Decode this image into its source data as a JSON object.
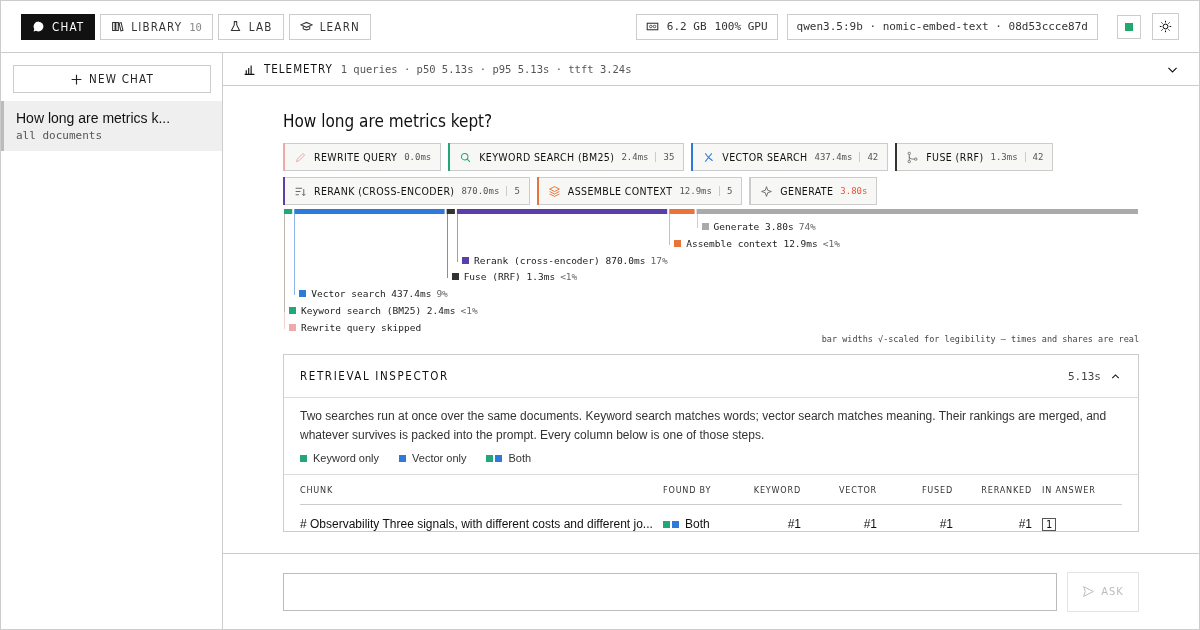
{
  "nav": {
    "tabs": [
      {
        "label": "CHAT",
        "selected": true
      },
      {
        "label": "LIBRARY",
        "count": "10",
        "selected": false
      },
      {
        "label": "LAB",
        "selected": false
      },
      {
        "label": "LEARN",
        "selected": false
      }
    ],
    "memory": "6.2 GB",
    "gpu": "100% GPU",
    "models": "qwen3.5:9b · nomic-embed-text · 08d53ccce87d"
  },
  "sidebar": {
    "new_chat": "NEW CHAT",
    "chats": [
      {
        "title": "How long are metrics k...",
        "scope": "all documents",
        "selected": true
      }
    ]
  },
  "telemetry": {
    "label": "TELEMETRY",
    "summary": "1 queries · p50 5.13s · p95 5.13s · ttft 3.24s",
    "expanded": false
  },
  "question": "How long are metrics kept?",
  "stages": [
    {
      "label": "REWRITE QUERY",
      "time": "0.0ms",
      "color": "#f0a8a8",
      "highlight": false
    },
    {
      "label": "KEYWORD SEARCH (BM25)",
      "time": "2.4ms",
      "count": "35",
      "color": "#22a67a",
      "highlight": false
    },
    {
      "label": "VECTOR SEARCH",
      "time": "437.4ms",
      "count": "42",
      "color": "#2f7ad8",
      "highlight": false
    },
    {
      "label": "FUSE (RRF)",
      "time": "1.3ms",
      "count": "42",
      "color": "#333333",
      "highlight": false
    },
    {
      "label": "RERANK (CROSS-ENCODER)",
      "time": "870.0ms",
      "count": "5",
      "color": "#5b3fa8",
      "highlight": false
    },
    {
      "label": "ASSEMBLE CONTEXT",
      "time": "12.9ms",
      "count": "5",
      "color": "#e8743b",
      "highlight": false
    },
    {
      "label": "GENERATE",
      "time": "3.80s",
      "color": "#cccccc",
      "highlight": true
    }
  ],
  "timeline": [
    {
      "label": "Generate 3.80s",
      "share": "74%",
      "color": "#aaaaaa"
    },
    {
      "label": "Assemble context 12.9ms",
      "share": "<1%",
      "color": "#e8743b"
    },
    {
      "label": "Rerank (cross-encoder) 870.0ms",
      "share": "17%",
      "color": "#5b3fa8"
    },
    {
      "label": "Fuse (RRF) 1.3ms",
      "share": "<1%",
      "color": "#333333"
    },
    {
      "label": "Vector search 437.4ms",
      "share": "9%",
      "color": "#2f7ad8"
    },
    {
      "label": "Keyword search (BM25) 2.4ms",
      "share": "<1%",
      "color": "#22a67a"
    },
    {
      "label": "Rewrite query skipped",
      "color": "#f0a8a8"
    }
  ],
  "timeline_note": "bar widths √-scaled for legibility — times and shares are real",
  "inspector": {
    "title": "RETRIEVAL INSPECTOR",
    "time": "5.13s",
    "expanded": true,
    "description": "Two searches run at once over the same documents. Keyword search matches words; vector search matches meaning. Their rankings are merged, and whatever survives is packed into the prompt. Every column below is one of those steps.",
    "legend": [
      {
        "label": "Keyword only",
        "kind": "keyword"
      },
      {
        "label": "Vector only",
        "kind": "vector"
      },
      {
        "label": "Both",
        "kind": "both"
      }
    ],
    "columns": [
      "CHUNK",
      "FOUND BY",
      "KEYWORD",
      "VECTOR",
      "FUSED",
      "RERANKED",
      "IN ANSWER"
    ],
    "rows": [
      {
        "chunk": "# Observability Three signals, with different costs and different jo...",
        "found_by": "Both",
        "kind": "both",
        "keyword": "#1",
        "vector": "#1",
        "fused": "#1",
        "reranked": "#1",
        "in_answer": "1"
      }
    ]
  },
  "composer": {
    "ask": "ASK",
    "disabled": true
  }
}
